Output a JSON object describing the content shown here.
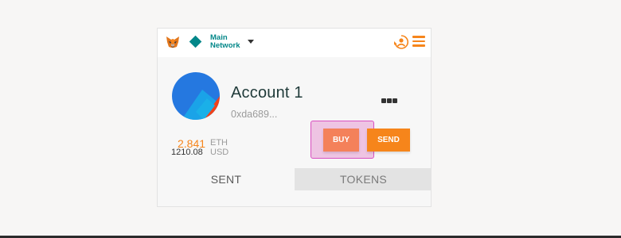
{
  "header": {
    "network_line1": "Main",
    "network_line2": "Network",
    "icons": [
      "metamask-fox-icon",
      "network-diamond-icon",
      "chevron-down-icon",
      "account-switch-icon",
      "menu-icon"
    ]
  },
  "account": {
    "name": "Account 1",
    "address": "0xda689..."
  },
  "balance": {
    "eth_amount": "2.841",
    "eth_unit": "ETH",
    "usd_amount": "1210.08",
    "usd_unit": "USD"
  },
  "actions": {
    "buy_label": "BUY",
    "send_label": "SEND"
  },
  "tabs": [
    {
      "label": "SENT",
      "active": true
    },
    {
      "label": "TOKENS",
      "active": false
    }
  ],
  "colors": {
    "accent": "#f6851b",
    "network": "#038789",
    "highlight": "#d94fc0"
  }
}
